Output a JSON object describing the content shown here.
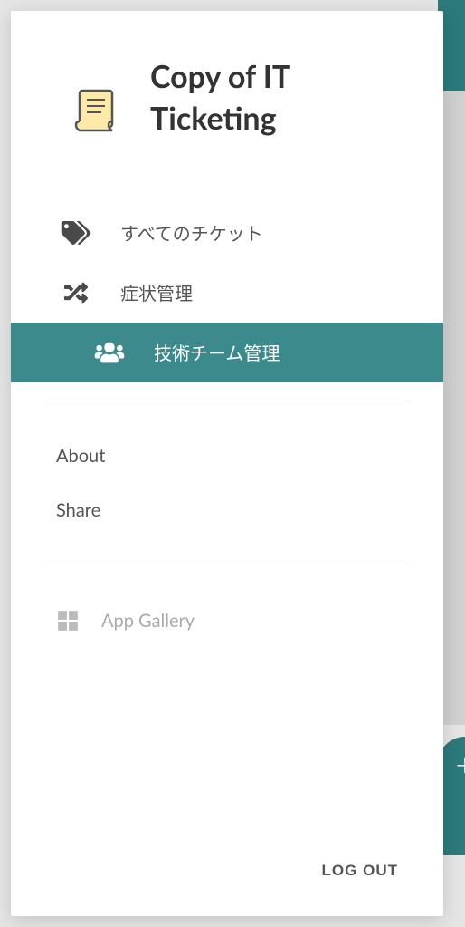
{
  "app": {
    "title": "Copy of IT Ticketing"
  },
  "nav": {
    "items": [
      {
        "label": "すべてのチケット"
      },
      {
        "label": "症状管理"
      },
      {
        "label": "技術チーム管理"
      }
    ]
  },
  "secondary": {
    "about": "About",
    "share": "Share"
  },
  "gallery": {
    "label": "App Gallery"
  },
  "footer": {
    "logout": "LOG OUT"
  },
  "fab": {
    "icon": "+"
  }
}
